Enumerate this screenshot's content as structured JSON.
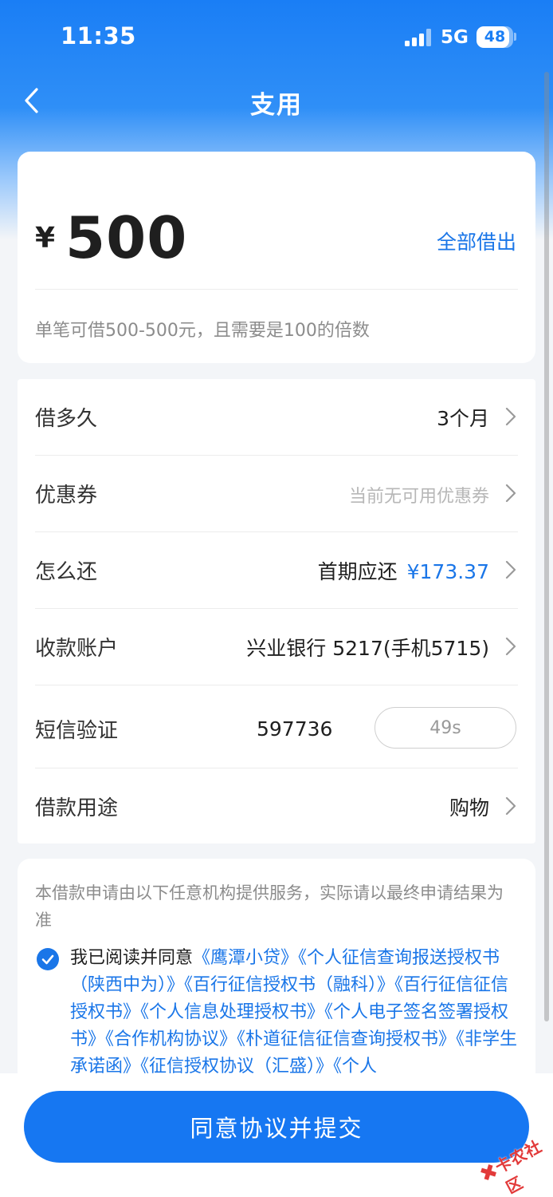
{
  "status_bar": {
    "time": "11:35",
    "network": "5G",
    "battery": "48"
  },
  "nav": {
    "title": "支用"
  },
  "amount": {
    "currency": "¥",
    "value": "500",
    "borrow_all_label": "全部借出",
    "hint": "单笔可借500-500元，且需要是100的倍数"
  },
  "rows": {
    "term": {
      "label": "借多久",
      "value": "3个月"
    },
    "coupon": {
      "label": "优惠券",
      "value": "当前无可用优惠券"
    },
    "repay": {
      "label": "怎么还",
      "value": "首期应还",
      "amount": "¥173.37"
    },
    "account": {
      "label": "收款账户",
      "value": "兴业银行 5217(手机5715)"
    },
    "sms": {
      "label": "短信验证",
      "code": "597736",
      "countdown": "49s"
    },
    "purpose": {
      "label": "借款用途",
      "value": "购物"
    }
  },
  "agreement": {
    "provider_note": "本借款申请由以下任意机构提供服务，实际请以最终申请结果为准",
    "prefix": "我已阅读并同意",
    "links": [
      "《鹰潭小贷》",
      "《个人征信查询报送授权书（陕西中为）》",
      "《百行征信授权书（融科）》",
      "《百行征信征信授权书》",
      "《个人信息处理授权书》",
      "《个人电子签名签署授权书》",
      "《合作机构协议》",
      "《朴道征信征信查询授权书》",
      "《非学生承诺函》",
      "《征信授权协议（汇盛）》",
      "《个人"
    ]
  },
  "submit": {
    "label": "同意协议并提交"
  },
  "watermark": {
    "text": "卡农社区"
  },
  "colors": {
    "brand_blue": "#1677f2",
    "link_blue": "#1a76e8"
  }
}
